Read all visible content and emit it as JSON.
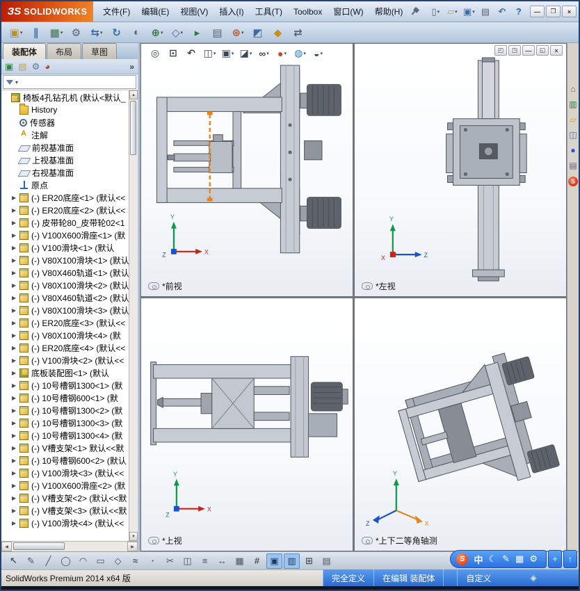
{
  "titlebar": {
    "logo_mark": "ЗS",
    "brand": "SOLIDWORKS",
    "menus": [
      "文件(F)",
      "编辑(E)",
      "视图(V)",
      "插入(I)",
      "工具(T)",
      "Toolbox",
      "窗口(W)",
      "帮助(H)"
    ],
    "quick_icons": [
      {
        "name": "new-document-icon",
        "glyph": "▯",
        "color": "#5a6470",
        "caret": "▾"
      },
      {
        "name": "open-icon",
        "glyph": "▱",
        "color": "#d9a020",
        "caret": "▾"
      },
      {
        "name": "save-icon",
        "glyph": "▣",
        "color": "#3a6ea8",
        "caret": "▾"
      },
      {
        "name": "print-icon",
        "glyph": "▤",
        "color": "#5a6470",
        "caret": ""
      },
      {
        "name": "undo-icon",
        "glyph": "↶",
        "color": "#3a6ea8",
        "caret": ""
      },
      {
        "name": "help-icon",
        "glyph": "?",
        "color": "#2a5aa8",
        "caret": ""
      }
    ],
    "window_buttons": [
      {
        "name": "minimize-button",
        "glyph": "—"
      },
      {
        "name": "restore-button",
        "glyph": "❐"
      },
      {
        "name": "close-button",
        "glyph": "×"
      }
    ]
  },
  "assembly_toolbar": [
    {
      "name": "insert-component-icon",
      "glyph": "▣",
      "color": "#c09020",
      "caret": "▾"
    },
    {
      "name": "mate-icon",
      "glyph": "∥",
      "color": "#3a6ea8",
      "caret": ""
    },
    {
      "name": "linear-pattern-icon",
      "glyph": "▦",
      "color": "#2f7a3f",
      "caret": "▾"
    },
    {
      "name": "smart-fasteners-icon",
      "glyph": "⚙",
      "color": "#5a6470",
      "caret": ""
    },
    {
      "name": "move-component-icon",
      "glyph": "⇆",
      "color": "#3a6ea8",
      "caret": "▾"
    },
    {
      "name": "rotate-component-icon",
      "glyph": "↻",
      "color": "#3a6ea8",
      "caret": ""
    },
    {
      "name": "show-hidden-icon",
      "glyph": "◐",
      "color": "#5a6470",
      "caret": ""
    },
    {
      "name": "assembly-features-icon",
      "glyph": "⊕",
      "color": "#2f7a3f",
      "caret": "▾"
    },
    {
      "name": "reference-geometry-icon",
      "glyph": "◇",
      "color": "#3a6ea8",
      "caret": "▾"
    },
    {
      "name": "motion-study-icon",
      "glyph": "▸",
      "color": "#2f7a3f",
      "caret": ""
    },
    {
      "name": "bom-icon",
      "glyph": "▤",
      "color": "#5a6470",
      "caret": ""
    },
    {
      "name": "exploded-view-icon",
      "glyph": "⊛",
      "color": "#c05a20",
      "caret": "▾"
    },
    {
      "name": "interference-icon",
      "glyph": "◩",
      "color": "#3a6ea8",
      "caret": ""
    },
    {
      "name": "instant3d-icon",
      "glyph": "◆",
      "color": "#c09020",
      "caret": ""
    },
    {
      "name": "external-references-icon",
      "glyph": "⇄",
      "color": "#5a6470",
      "caret": ""
    }
  ],
  "command_tabs": {
    "items": [
      {
        "label": "装配体",
        "active": true
      },
      {
        "label": "布局",
        "active": false
      },
      {
        "label": "草图",
        "active": false
      }
    ]
  },
  "panel": {
    "manager_tabs": [
      {
        "name": "feature-manager-tab-icon",
        "glyph": "▣",
        "color": "#2f8a3f"
      },
      {
        "name": "property-manager-tab-icon",
        "glyph": "▤",
        "color": "#d9a020"
      },
      {
        "name": "configuration-manager-tab-icon",
        "glyph": "⚙",
        "color": "#5a7a9a"
      },
      {
        "name": "display-manager-tab-icon",
        "glyph": "◕",
        "color": "#b04040"
      }
    ],
    "overflow": "»",
    "tree": [
      {
        "ind": 0,
        "arrow": "",
        "icon": "assembly-root",
        "label": "椅板4孔钻孔机 (默认<默认_"
      },
      {
        "ind": 1,
        "arrow": "",
        "icon": "folder-history",
        "label": "History"
      },
      {
        "ind": 1,
        "arrow": "",
        "icon": "sensor",
        "label": "传感器"
      },
      {
        "ind": 1,
        "arrow": "",
        "icon": "annotation",
        "label": "注解"
      },
      {
        "ind": 1,
        "arrow": "",
        "icon": "plane",
        "label": "前视基准面"
      },
      {
        "ind": 1,
        "arrow": "",
        "icon": "plane",
        "label": "上视基准面"
      },
      {
        "ind": 1,
        "arrow": "",
        "icon": "plane",
        "label": "右视基准面"
      },
      {
        "ind": 1,
        "arrow": "",
        "icon": "origin",
        "label": "原点"
      },
      {
        "ind": 1,
        "arrow": "▶",
        "icon": "part",
        "label": "(-) ER20底座<1> (默认<<"
      },
      {
        "ind": 1,
        "arrow": "▶",
        "icon": "part",
        "label": "(-) ER20底座<2> (默认<<"
      },
      {
        "ind": 1,
        "arrow": "▶",
        "icon": "part",
        "label": "(-) 皮带轮80_皮带轮02<1"
      },
      {
        "ind": 1,
        "arrow": "▶",
        "icon": "part",
        "label": "(-) V100X600滑座<1> (默"
      },
      {
        "ind": 1,
        "arrow": "▶",
        "icon": "part",
        "label": "(-) V100滑块<1> (默认"
      },
      {
        "ind": 1,
        "arrow": "▶",
        "icon": "part",
        "label": "(-) V80X100滑块<1> (默认"
      },
      {
        "ind": 1,
        "arrow": "▶",
        "icon": "part",
        "label": "(-) V80X460轨道<1> (默认"
      },
      {
        "ind": 1,
        "arrow": "▶",
        "icon": "part",
        "label": "(-) V80X100滑块<2> (默认"
      },
      {
        "ind": 1,
        "arrow": "▶",
        "icon": "part",
        "label": "(-) V80X460轨道<2> (默认"
      },
      {
        "ind": 1,
        "arrow": "▶",
        "icon": "part",
        "label": "(-) V80X100滑块<3> (默认"
      },
      {
        "ind": 1,
        "arrow": "▶",
        "icon": "part",
        "label": "(-) ER20底座<3> (默认<<"
      },
      {
        "ind": 1,
        "arrow": "▶",
        "icon": "part",
        "label": "(-) V80X100滑块<4> (默"
      },
      {
        "ind": 1,
        "arrow": "▶",
        "icon": "part",
        "label": "(-) ER20底座<4> (默认<<"
      },
      {
        "ind": 1,
        "arrow": "▶",
        "icon": "part",
        "label": "(-) V100滑块<2> (默认<<"
      },
      {
        "ind": 1,
        "arrow": "▶",
        "icon": "subassembly",
        "label": "底板装配图<1> (默认"
      },
      {
        "ind": 1,
        "arrow": "▶",
        "icon": "part",
        "label": "(-) 10号槽钢1300<1> (默"
      },
      {
        "ind": 1,
        "arrow": "▶",
        "icon": "part",
        "label": "(-) 10号槽钢600<1> (默"
      },
      {
        "ind": 1,
        "arrow": "▶",
        "icon": "part",
        "label": "(-) 10号槽钢1300<2> (默"
      },
      {
        "ind": 1,
        "arrow": "▶",
        "icon": "part",
        "label": "(-) 10号槽钢1300<3> (默"
      },
      {
        "ind": 1,
        "arrow": "▶",
        "icon": "part",
        "label": "(-) 10号槽钢1300<4> (默"
      },
      {
        "ind": 1,
        "arrow": "▶",
        "icon": "part",
        "label": "(-) V槽支架<1> 默认<<默"
      },
      {
        "ind": 1,
        "arrow": "▶",
        "icon": "part",
        "label": "(-) 10号槽钢600<2> (默认"
      },
      {
        "ind": 1,
        "arrow": "▶",
        "icon": "part",
        "label": "(-) V100滑块<3> (默认<<"
      },
      {
        "ind": 1,
        "arrow": "▶",
        "icon": "part",
        "label": "(-) V100X600滑座<2> (默"
      },
      {
        "ind": 1,
        "arrow": "▶",
        "icon": "part",
        "label": "(-) V槽支架<2> (默认<<默"
      },
      {
        "ind": 1,
        "arrow": "▶",
        "icon": "part",
        "label": "(-) V槽支架<3> (默认<<默"
      },
      {
        "ind": 1,
        "arrow": "▶",
        "icon": "part",
        "label": "(-) V100滑块<4> (默认<<"
      }
    ]
  },
  "headsup_toolbar": [
    {
      "name": "zoom-fit-icon",
      "glyph": "◎",
      "color": "#3c4754",
      "caret": ""
    },
    {
      "name": "zoom-area-icon",
      "glyph": "⊡",
      "color": "#3c4754",
      "caret": ""
    },
    {
      "name": "previous-view-icon",
      "glyph": "↶",
      "color": "#3c4754",
      "caret": ""
    },
    {
      "name": "section-view-icon",
      "glyph": "◫",
      "color": "#3c4754",
      "caret": "▾"
    },
    {
      "name": "view-orientation-icon",
      "glyph": "▣",
      "color": "#3c4754",
      "caret": "▾"
    },
    {
      "name": "display-style-icon",
      "glyph": "◪",
      "color": "#3c4754",
      "caret": "▾"
    },
    {
      "name": "hide-show-items-icon",
      "glyph": "∞",
      "color": "#3c4754",
      "caret": "▾"
    },
    {
      "name": "edit-appearance-icon",
      "glyph": "●",
      "color": "#c84a20",
      "caret": "▾"
    },
    {
      "name": "apply-scene-icon",
      "glyph": "◍",
      "color": "#3a7ab0",
      "caret": "▾"
    },
    {
      "name": "view-settings-icon",
      "glyph": "◒",
      "color": "#3c4754",
      "caret": "▾"
    }
  ],
  "doc_controls": [
    {
      "name": "viewport-layout-single-icon",
      "glyph": "◰"
    },
    {
      "name": "viewport-layout-four-icon",
      "glyph": "◳"
    },
    {
      "name": "doc-minimize-icon",
      "glyph": "—"
    },
    {
      "name": "doc-restore-icon",
      "glyph": "◱"
    },
    {
      "name": "doc-close-icon",
      "glyph": "×"
    }
  ],
  "viewport": {
    "panes": [
      {
        "label": "*前视"
      },
      {
        "label": "*左视"
      },
      {
        "label": "*上视"
      },
      {
        "label": "*上下二等角轴测"
      }
    ]
  },
  "axes": {
    "x": "X",
    "y": "Y",
    "z": "Z"
  },
  "task_pane": [
    {
      "name": "resources-home-icon",
      "glyph": "⌂",
      "color": "#7a5a30"
    },
    {
      "name": "design-library-icon",
      "glyph": "▥",
      "color": "#2f7a3f"
    },
    {
      "name": "file-explorer-icon",
      "glyph": "▱",
      "color": "#d9a020"
    },
    {
      "name": "view-palette-icon",
      "glyph": "◫",
      "color": "#4a6a9a"
    },
    {
      "name": "appearances-icon",
      "glyph": "●",
      "color": "#2255cc"
    },
    {
      "name": "custom-properties-icon",
      "glyph": "▤",
      "color": "#5a6470"
    }
  ],
  "task_badge": "S",
  "sketch_toolbar": [
    {
      "name": "select-icon",
      "glyph": "↖",
      "active": false
    },
    {
      "name": "sketch-pencil-icon",
      "glyph": "✎",
      "active": false
    },
    {
      "name": "line-icon",
      "glyph": "╱",
      "active": false
    },
    {
      "name": "circle-icon",
      "glyph": "◯",
      "active": false
    },
    {
      "name": "arc-icon",
      "glyph": "◠",
      "active": false
    },
    {
      "name": "rectangle-icon",
      "glyph": "▭",
      "active": false
    },
    {
      "name": "polygon-icon",
      "glyph": "◇",
      "active": false
    },
    {
      "name": "spline-icon",
      "glyph": "≈",
      "active": false
    },
    {
      "name": "point-icon",
      "glyph": "∙",
      "active": false
    },
    {
      "name": "trim-icon",
      "glyph": "✂",
      "active": false
    },
    {
      "name": "mirror-icon",
      "glyph": "◫",
      "active": false
    },
    {
      "name": "offset-icon",
      "glyph": "≡",
      "active": false
    },
    {
      "name": "dimension-icon",
      "glyph": "↔",
      "active": false
    },
    {
      "name": "pattern-icon",
      "glyph": "▦",
      "active": false
    },
    {
      "name": "hatch-icon",
      "glyph": "#",
      "active": false
    },
    {
      "name": "normal-to-icon",
      "glyph": "▣",
      "active": true
    },
    {
      "name": "shaded-view-icon",
      "glyph": "▥",
      "active": true
    },
    {
      "name": "grid-icon",
      "glyph": "⊞",
      "active": false
    },
    {
      "name": "table-icon",
      "glyph": "▤",
      "active": false
    }
  ],
  "ime": {
    "logo": "S",
    "items": [
      {
        "name": "ime-mode-label",
        "glyph": "中"
      },
      {
        "name": "ime-moon-icon",
        "glyph": "☾"
      },
      {
        "name": "ime-pen-icon",
        "glyph": "✎"
      },
      {
        "name": "ime-keyboard-icon",
        "glyph": "▦"
      },
      {
        "name": "ime-tools-icon",
        "glyph": "⚙"
      }
    ],
    "extra": [
      {
        "name": "ime-plus-icon",
        "glyph": "+",
        "color": "#9fe89f"
      },
      {
        "name": "ime-up-icon",
        "glyph": "↑",
        "color": "#ffffff"
      }
    ]
  },
  "statusbar": {
    "product": "SolidWorks Premium 2014 x64 版",
    "defined": "完全定义",
    "editing": "在编辑 装配体",
    "custom": "自定义"
  }
}
